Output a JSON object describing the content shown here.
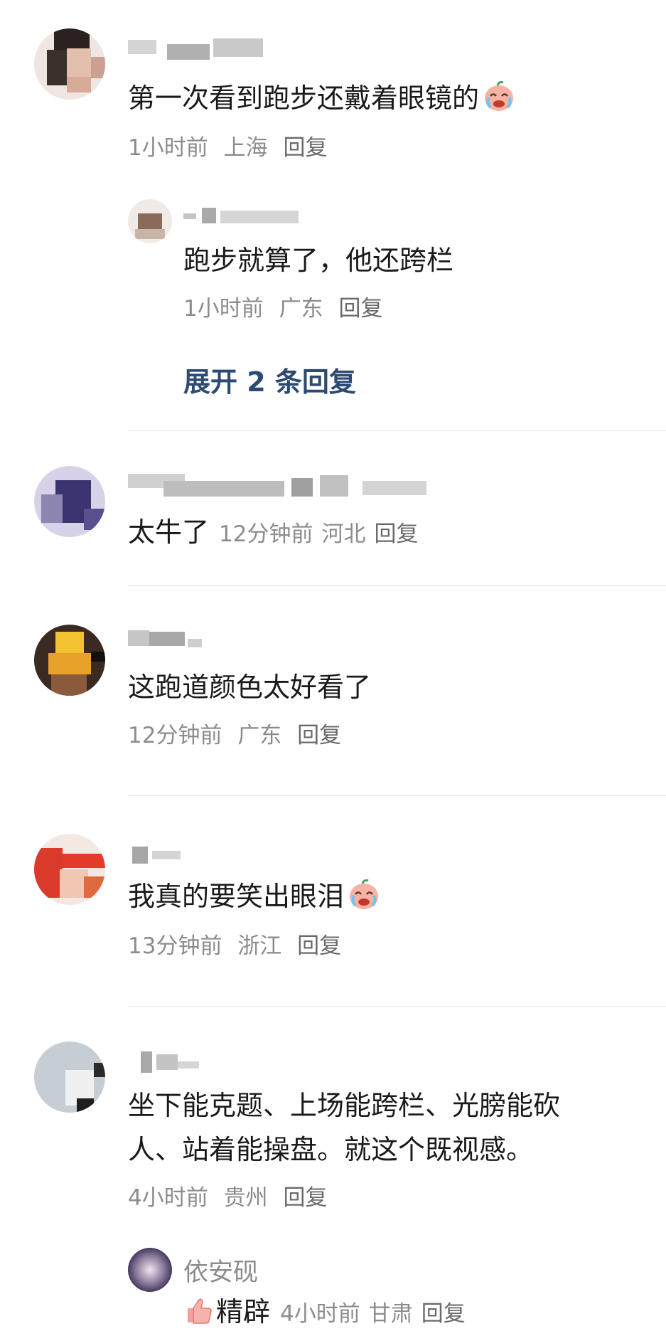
{
  "comments": [
    {
      "text": "第一次看到跑步还戴着眼镜的",
      "emoji": "crying-laughing-face-icon",
      "meta": {
        "time": "1小时前",
        "location": "上海",
        "reply": "回复"
      },
      "replies": [
        {
          "text": "跑步就算了，他还跨栏",
          "meta": {
            "time": "1小时前",
            "location": "广东",
            "reply": "回复"
          }
        }
      ],
      "expand_label": "展开 2 条回复"
    },
    {
      "text": "太牛了",
      "meta": {
        "time": "12分钟前",
        "location": "河北",
        "reply": "回复"
      }
    },
    {
      "text": "这跑道颜色太好看了",
      "meta": {
        "time": "12分钟前",
        "location": "广东",
        "reply": "回复"
      }
    },
    {
      "text": "我真的要笑出眼泪",
      "emoji": "crying-laughing-face-icon",
      "meta": {
        "time": "13分钟前",
        "location": "浙江",
        "reply": "回复"
      }
    },
    {
      "text_line1": "坐下能克题、上场能跨栏、光膀能砍",
      "text_line2": "人、站着能操盘。就这个既视感。",
      "meta": {
        "time": "4小时前",
        "location": "贵州",
        "reply": "回复"
      },
      "replies": [
        {
          "username": "依安砚",
          "emoji": "thumbs-up-icon",
          "text": "精辟",
          "meta": {
            "time": "4小时前",
            "location": "甘肃",
            "reply": "回复"
          }
        }
      ]
    }
  ],
  "colors": {
    "text": "#1a1a1a",
    "meta": "#8c8c8c",
    "expand": "#2c4a72",
    "divider": "#e6e6e6"
  }
}
